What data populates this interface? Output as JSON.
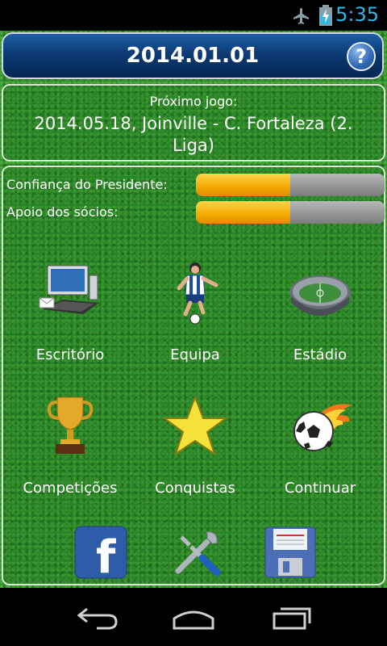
{
  "status_bar": {
    "time": "5:35",
    "icons": [
      "airplane-mode-icon",
      "battery-charging-icon"
    ],
    "accent_color": "#33b5e5"
  },
  "header": {
    "date": "2014.01.01",
    "help_label": "?"
  },
  "next_match": {
    "label": "Próximo jogo:",
    "text": "2014.05.18, Joinville - C. Fortaleza (2. Liga)"
  },
  "stats": [
    {
      "label": "Confiança do Presidente:",
      "level": 0.5
    },
    {
      "label": "Apoio dos sócios:",
      "level": 0.5
    }
  ],
  "menu": [
    {
      "label": "Escritório",
      "icon": "office-computer-icon"
    },
    {
      "label": "Equipa",
      "icon": "football-player-icon"
    },
    {
      "label": "Estádio",
      "icon": "stadium-icon"
    },
    {
      "label": "Competições",
      "icon": "trophy-icon"
    },
    {
      "label": "Conquistas",
      "icon": "star-icon"
    },
    {
      "label": "Continuar",
      "icon": "flaming-ball-icon"
    }
  ],
  "bottom_actions": [
    {
      "icon": "facebook-icon",
      "glyph": "f"
    },
    {
      "icon": "tools-icon"
    },
    {
      "icon": "save-floppy-icon"
    }
  ],
  "colors": {
    "header_blue": "#0d3b75",
    "bar_fill": "#f2a900",
    "bar_empty": "#8a8a8a",
    "grass": "#2f8f2f"
  }
}
